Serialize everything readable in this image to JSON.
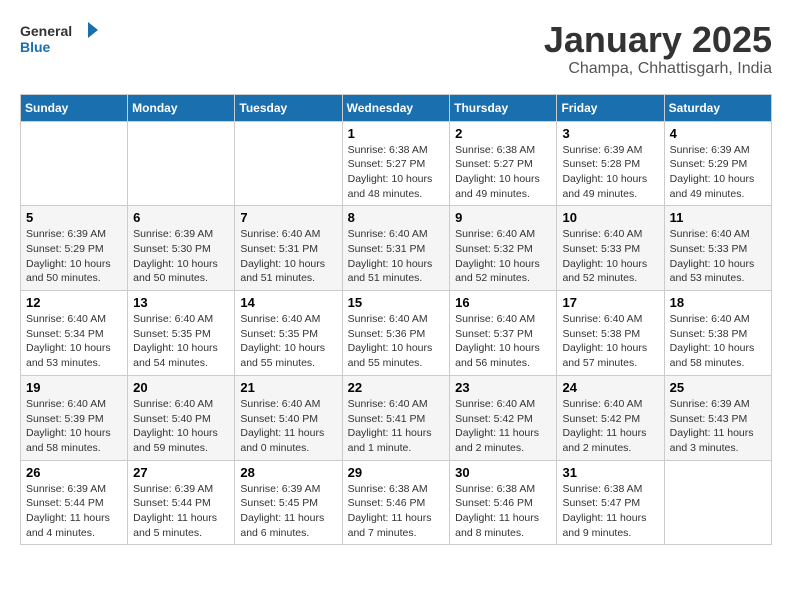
{
  "logo": {
    "line1": "General",
    "line2": "Blue"
  },
  "title": "January 2025",
  "subtitle": "Champa, Chhattisgarh, India",
  "headers": [
    "Sunday",
    "Monday",
    "Tuesday",
    "Wednesday",
    "Thursday",
    "Friday",
    "Saturday"
  ],
  "weeks": [
    [
      {
        "day": "",
        "info": ""
      },
      {
        "day": "",
        "info": ""
      },
      {
        "day": "",
        "info": ""
      },
      {
        "day": "1",
        "info": "Sunrise: 6:38 AM\nSunset: 5:27 PM\nDaylight: 10 hours\nand 48 minutes."
      },
      {
        "day": "2",
        "info": "Sunrise: 6:38 AM\nSunset: 5:27 PM\nDaylight: 10 hours\nand 49 minutes."
      },
      {
        "day": "3",
        "info": "Sunrise: 6:39 AM\nSunset: 5:28 PM\nDaylight: 10 hours\nand 49 minutes."
      },
      {
        "day": "4",
        "info": "Sunrise: 6:39 AM\nSunset: 5:29 PM\nDaylight: 10 hours\nand 49 minutes."
      }
    ],
    [
      {
        "day": "5",
        "info": "Sunrise: 6:39 AM\nSunset: 5:29 PM\nDaylight: 10 hours\nand 50 minutes."
      },
      {
        "day": "6",
        "info": "Sunrise: 6:39 AM\nSunset: 5:30 PM\nDaylight: 10 hours\nand 50 minutes."
      },
      {
        "day": "7",
        "info": "Sunrise: 6:40 AM\nSunset: 5:31 PM\nDaylight: 10 hours\nand 51 minutes."
      },
      {
        "day": "8",
        "info": "Sunrise: 6:40 AM\nSunset: 5:31 PM\nDaylight: 10 hours\nand 51 minutes."
      },
      {
        "day": "9",
        "info": "Sunrise: 6:40 AM\nSunset: 5:32 PM\nDaylight: 10 hours\nand 52 minutes."
      },
      {
        "day": "10",
        "info": "Sunrise: 6:40 AM\nSunset: 5:33 PM\nDaylight: 10 hours\nand 52 minutes."
      },
      {
        "day": "11",
        "info": "Sunrise: 6:40 AM\nSunset: 5:33 PM\nDaylight: 10 hours\nand 53 minutes."
      }
    ],
    [
      {
        "day": "12",
        "info": "Sunrise: 6:40 AM\nSunset: 5:34 PM\nDaylight: 10 hours\nand 53 minutes."
      },
      {
        "day": "13",
        "info": "Sunrise: 6:40 AM\nSunset: 5:35 PM\nDaylight: 10 hours\nand 54 minutes."
      },
      {
        "day": "14",
        "info": "Sunrise: 6:40 AM\nSunset: 5:35 PM\nDaylight: 10 hours\nand 55 minutes."
      },
      {
        "day": "15",
        "info": "Sunrise: 6:40 AM\nSunset: 5:36 PM\nDaylight: 10 hours\nand 55 minutes."
      },
      {
        "day": "16",
        "info": "Sunrise: 6:40 AM\nSunset: 5:37 PM\nDaylight: 10 hours\nand 56 minutes."
      },
      {
        "day": "17",
        "info": "Sunrise: 6:40 AM\nSunset: 5:38 PM\nDaylight: 10 hours\nand 57 minutes."
      },
      {
        "day": "18",
        "info": "Sunrise: 6:40 AM\nSunset: 5:38 PM\nDaylight: 10 hours\nand 58 minutes."
      }
    ],
    [
      {
        "day": "19",
        "info": "Sunrise: 6:40 AM\nSunset: 5:39 PM\nDaylight: 10 hours\nand 58 minutes."
      },
      {
        "day": "20",
        "info": "Sunrise: 6:40 AM\nSunset: 5:40 PM\nDaylight: 10 hours\nand 59 minutes."
      },
      {
        "day": "21",
        "info": "Sunrise: 6:40 AM\nSunset: 5:40 PM\nDaylight: 11 hours\nand 0 minutes."
      },
      {
        "day": "22",
        "info": "Sunrise: 6:40 AM\nSunset: 5:41 PM\nDaylight: 11 hours\nand 1 minute."
      },
      {
        "day": "23",
        "info": "Sunrise: 6:40 AM\nSunset: 5:42 PM\nDaylight: 11 hours\nand 2 minutes."
      },
      {
        "day": "24",
        "info": "Sunrise: 6:40 AM\nSunset: 5:42 PM\nDaylight: 11 hours\nand 2 minutes."
      },
      {
        "day": "25",
        "info": "Sunrise: 6:39 AM\nSunset: 5:43 PM\nDaylight: 11 hours\nand 3 minutes."
      }
    ],
    [
      {
        "day": "26",
        "info": "Sunrise: 6:39 AM\nSunset: 5:44 PM\nDaylight: 11 hours\nand 4 minutes."
      },
      {
        "day": "27",
        "info": "Sunrise: 6:39 AM\nSunset: 5:44 PM\nDaylight: 11 hours\nand 5 minutes."
      },
      {
        "day": "28",
        "info": "Sunrise: 6:39 AM\nSunset: 5:45 PM\nDaylight: 11 hours\nand 6 minutes."
      },
      {
        "day": "29",
        "info": "Sunrise: 6:38 AM\nSunset: 5:46 PM\nDaylight: 11 hours\nand 7 minutes."
      },
      {
        "day": "30",
        "info": "Sunrise: 6:38 AM\nSunset: 5:46 PM\nDaylight: 11 hours\nand 8 minutes."
      },
      {
        "day": "31",
        "info": "Sunrise: 6:38 AM\nSunset: 5:47 PM\nDaylight: 11 hours\nand 9 minutes."
      },
      {
        "day": "",
        "info": ""
      }
    ]
  ]
}
